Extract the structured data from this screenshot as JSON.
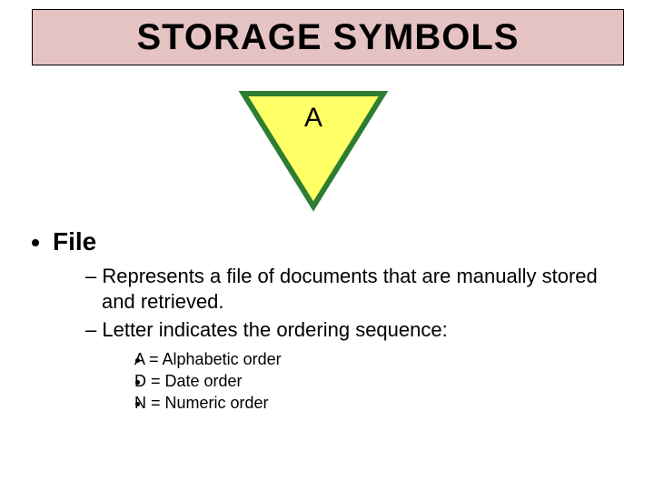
{
  "title": "STORAGE SYMBOLS",
  "symbol": {
    "letter": "A",
    "fill": "#ffff66",
    "stroke": "#2e7d32"
  },
  "bullets": {
    "l1": "File",
    "l2a": "Represents a file of documents that are manually stored and retrieved.",
    "l2b": "Letter indicates the ordering sequence:",
    "l3a": "A = Alphabetic order",
    "l3b": "D = Date order",
    "l3c": "N = Numeric order"
  }
}
